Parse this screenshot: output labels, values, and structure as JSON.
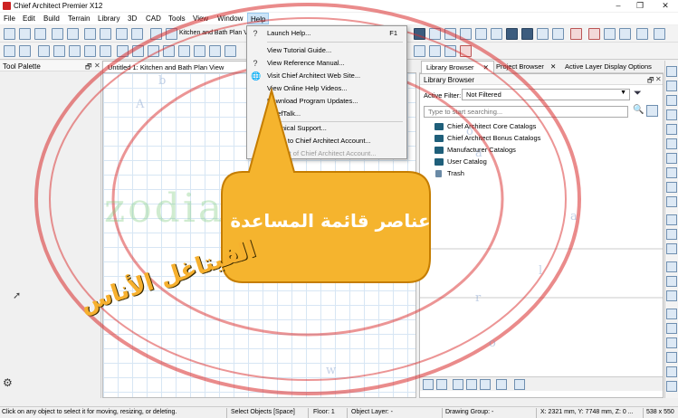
{
  "window": {
    "title": "Chief Architect Premier X12",
    "controls": [
      "–",
      "❐",
      "✕"
    ]
  },
  "menubar": {
    "items": [
      "File",
      "Edit",
      "Build",
      "Terrain",
      "Library",
      "3D",
      "CAD",
      "Tools",
      "View",
      "Window",
      "Help"
    ],
    "active": "Help"
  },
  "toolbar": {
    "view_button_label": "Kitchen and Bath Plan V"
  },
  "tool_palette": {
    "title": "Tool Palette",
    "pin": "🗗",
    "close": "✕"
  },
  "plan_view": {
    "tab_label": "Untitled 1: Kitchen and Bath Plan View"
  },
  "help_menu": {
    "items": [
      {
        "label": "Launch Help...",
        "shortcut": "F1",
        "icon": "question-icon",
        "enabled": true
      },
      {
        "label": "View Tutorial Guide...",
        "shortcut": "",
        "icon": "",
        "enabled": true
      },
      {
        "label": "View Reference Manual...",
        "shortcut": "",
        "icon": "book-help-icon",
        "enabled": true
      },
      {
        "label": "Visit Chief Architect Web Site...",
        "shortcut": "",
        "icon": "globe-icon",
        "enabled": true
      },
      {
        "label": "View Online Help Videos...",
        "shortcut": "",
        "icon": "",
        "enabled": true
      },
      {
        "label": "Download Program Updates...",
        "shortcut": "",
        "icon": "",
        "enabled": true
      },
      {
        "label": "ChiefTalk...",
        "shortcut": "",
        "icon": "",
        "enabled": true
      },
      {
        "label": "Technical Support...",
        "shortcut": "",
        "icon": "",
        "enabled": true
      },
      {
        "label": "Log In to Chief Architect Account...",
        "shortcut": "",
        "icon": "",
        "enabled": true
      },
      {
        "label": "Log Out of Chief Architect Account...",
        "shortcut": "",
        "icon": "",
        "enabled": false
      }
    ]
  },
  "library_browser": {
    "tabs": [
      {
        "label": "Library Browser",
        "active": true
      },
      {
        "label": "Project Browser",
        "active": false
      },
      {
        "label": "Active Layer Display Options",
        "active": false
      }
    ],
    "title": "Library Browser",
    "filter_label": "Active Filter:",
    "filter_value": "Not Filtered",
    "search_placeholder": "Type to start searching...",
    "tree": [
      {
        "label": "Chief Architect Core Catalogs",
        "icon": "catalog-folder-icon"
      },
      {
        "label": "Chief Architect Bonus Catalogs",
        "icon": "catalog-folder-icon"
      },
      {
        "label": "Manufacturer Catalogs",
        "icon": "catalog-folder-icon"
      },
      {
        "label": "User Catalog",
        "icon": "folder-icon"
      },
      {
        "label": "Trash",
        "icon": "trash-icon"
      }
    ]
  },
  "statusbar": {
    "hint": "Click on any object to select it for moving, resizing, or deleting.",
    "mode": "Select Objects [Space]",
    "floor": "Floor: 1",
    "object_layer": "Object Layer: -",
    "drawing_group": "Drawing Group: -",
    "coords": "X: 2321 mm, Y: 7748 mm, Z: 0 ...",
    "size": "538 x 550"
  },
  "overlay": {
    "callout_text": "عناصر قائمة المساعدة",
    "watermark_url": "zodiack2002",
    "brand_text": "الفيتاغل الأناس",
    "ring_letters": [
      "A",
      "b",
      "o",
      "a",
      "r",
      "w",
      "o",
      "l",
      "a"
    ]
  },
  "colors": {
    "callout": "#f5b42e",
    "callout_border": "#c57d00",
    "ring": "#d92b2b",
    "menu_highlight": "#cce4f7"
  }
}
